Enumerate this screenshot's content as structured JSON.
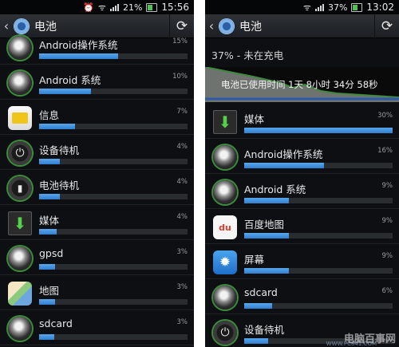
{
  "left": {
    "status": {
      "battery_pct": "21%",
      "time": "15:56"
    },
    "title": "电池",
    "items": [
      {
        "name": "Android操作系统",
        "pct": "15%",
        "level": 0.53,
        "icon": "android-os-icon"
      },
      {
        "name": "Android 系统",
        "pct": "10%",
        "level": 0.35,
        "icon": "android-system-icon"
      },
      {
        "name": "信息",
        "pct": "7%",
        "level": 0.24,
        "icon": "messages-icon"
      },
      {
        "name": "设备待机",
        "pct": "4%",
        "level": 0.14,
        "icon": "device-standby-icon"
      },
      {
        "name": "电池待机",
        "pct": "4%",
        "level": 0.14,
        "icon": "cell-standby-icon"
      },
      {
        "name": "媒体",
        "pct": "4%",
        "level": 0.12,
        "icon": "media-icon"
      },
      {
        "name": "gpsd",
        "pct": "3%",
        "level": 0.11,
        "icon": "gpsd-icon"
      },
      {
        "name": "地图",
        "pct": "3%",
        "level": 0.11,
        "icon": "maps-icon"
      },
      {
        "name": "sdcard",
        "pct": "3%",
        "level": 0.1,
        "icon": "sdcard-icon"
      }
    ]
  },
  "right": {
    "status": {
      "battery_pct": "37%",
      "time": "13:02"
    },
    "title": "电池",
    "charge_status": "37% - 未在充电",
    "usage_time": "电池已使用时间 1天 8小时 34分 58秒",
    "items": [
      {
        "name": "媒体",
        "pct": "30%",
        "level": 1.0,
        "icon": "media-icon"
      },
      {
        "name": "Android操作系统",
        "pct": "16%",
        "level": 0.54,
        "icon": "android-os-icon"
      },
      {
        "name": "Android 系统",
        "pct": "9%",
        "level": 0.3,
        "icon": "android-system-icon"
      },
      {
        "name": "百度地图",
        "pct": "9%",
        "level": 0.3,
        "icon": "baidu-map-icon"
      },
      {
        "name": "屏幕",
        "pct": "9%",
        "level": 0.3,
        "icon": "screen-icon"
      },
      {
        "name": "sdcard",
        "pct": "6%",
        "level": 0.19,
        "icon": "sdcard-icon"
      },
      {
        "name": "设备待机",
        "pct": "",
        "level": 0.16,
        "icon": "device-standby-icon"
      }
    ],
    "watermark": "电脑百事网",
    "watermark_url": "WWW.PC841.COM"
  },
  "colors": {
    "bar_fill": "#3d8fdc",
    "bar_track": "#2a2d30",
    "graph_green": "#3f8a3f",
    "graph_fill": "#6f7370"
  }
}
